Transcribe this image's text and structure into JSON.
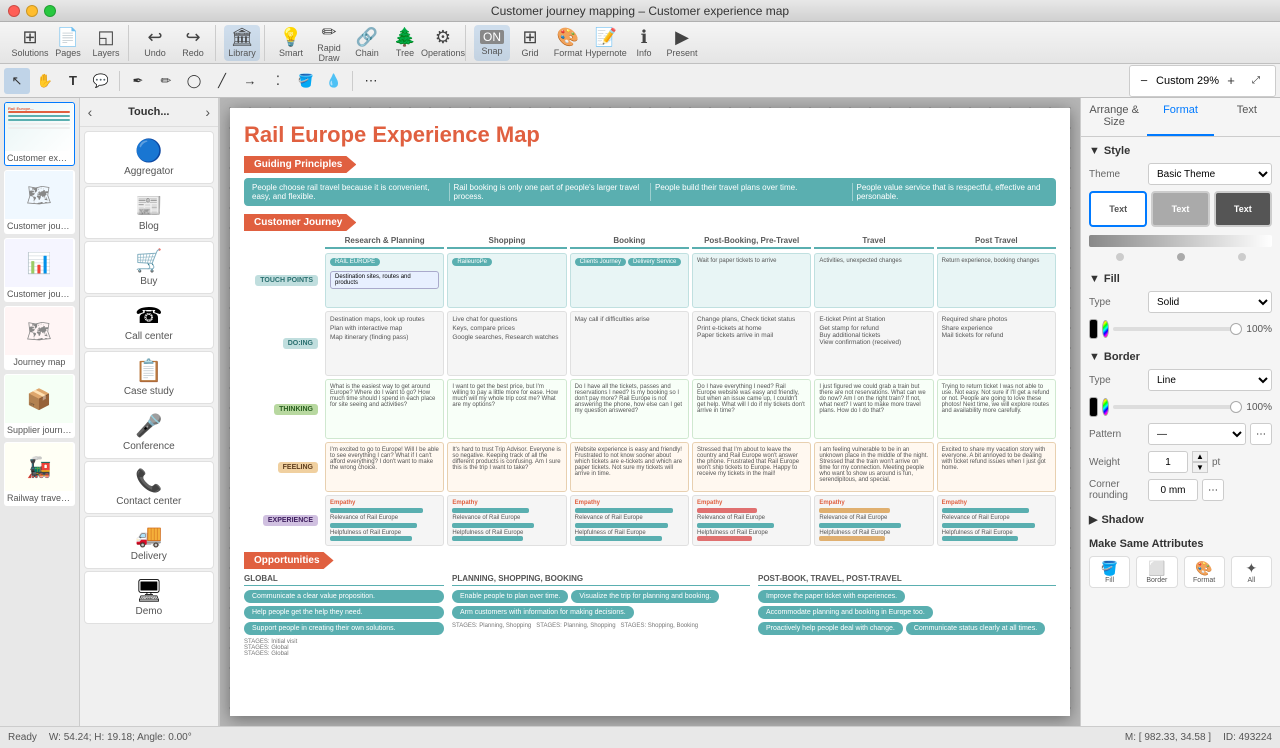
{
  "window": {
    "title": "Customer journey mapping – Customer experience map"
  },
  "toolbar_top": {
    "sections": [
      {
        "items": [
          {
            "id": "solutions",
            "label": "Solutions",
            "icon": "⊞"
          },
          {
            "id": "pages",
            "label": "Pages",
            "icon": "📄"
          },
          {
            "id": "layers",
            "label": "Layers",
            "icon": "◱"
          }
        ]
      },
      {
        "items": [
          {
            "id": "undo",
            "label": "Undo",
            "icon": "↩"
          },
          {
            "id": "redo",
            "label": "Redo",
            "icon": "↪"
          }
        ]
      },
      {
        "items": [
          {
            "id": "library",
            "label": "Library",
            "icon": "🏛",
            "active": true
          }
        ]
      },
      {
        "items": [
          {
            "id": "smart",
            "label": "Smart",
            "icon": "💡"
          },
          {
            "id": "rapid-draw",
            "label": "Rapid Draw",
            "icon": "✏"
          },
          {
            "id": "chain",
            "label": "Chain",
            "icon": "🔗"
          },
          {
            "id": "tree",
            "label": "Tree",
            "icon": "🌲"
          },
          {
            "id": "operations",
            "label": "Operations",
            "icon": "⚙"
          }
        ]
      },
      {
        "items": [
          {
            "id": "snap",
            "label": "Snap",
            "icon": "⊞",
            "active": true
          },
          {
            "id": "grid",
            "label": "Grid",
            "icon": "⊞"
          },
          {
            "id": "format",
            "label": "Format",
            "icon": "🎨"
          },
          {
            "id": "hypernote",
            "label": "Hypernote",
            "icon": "📝"
          },
          {
            "id": "info",
            "label": "Info",
            "icon": "ℹ"
          },
          {
            "id": "present",
            "label": "Present",
            "icon": "▶"
          }
        ]
      }
    ]
  },
  "tools": {
    "items": [
      {
        "id": "select",
        "icon": "↖",
        "active": true
      },
      {
        "id": "hand",
        "icon": "✋"
      },
      {
        "id": "text",
        "icon": "T"
      },
      {
        "id": "note",
        "icon": "💬"
      },
      {
        "id": "separator1"
      },
      {
        "id": "pen",
        "icon": "✒"
      },
      {
        "id": "pencil",
        "icon": "✏"
      },
      {
        "id": "shape",
        "icon": "◯"
      },
      {
        "id": "line",
        "icon": "╱"
      },
      {
        "id": "arrow",
        "icon": "→"
      },
      {
        "id": "eraser",
        "icon": "⬛"
      },
      {
        "id": "paintbucket",
        "icon": "🪣"
      },
      {
        "id": "eyedropper",
        "icon": "💧"
      },
      {
        "id": "separator2"
      },
      {
        "id": "more",
        "icon": "⋯"
      }
    ],
    "zoom": {
      "zoom_out": "−",
      "value": "Custom 29%",
      "zoom_in": "+"
    }
  },
  "library_panel": {
    "title": "Touch...",
    "prev_label": "‹",
    "next_label": "›",
    "items": [
      {
        "id": "aggregator",
        "icon": "🔵",
        "name": "Aggregator"
      },
      {
        "id": "blog",
        "icon": "📰",
        "name": "Blog"
      },
      {
        "id": "buy",
        "icon": "🛒",
        "name": "Buy"
      },
      {
        "id": "call-center",
        "icon": "☎",
        "name": "Call center"
      },
      {
        "id": "case-study",
        "icon": "📋",
        "name": "Case study"
      },
      {
        "id": "conference",
        "icon": "🎤",
        "name": "Conference"
      },
      {
        "id": "contact-center",
        "icon": "📞",
        "name": "Contact center"
      },
      {
        "id": "delivery",
        "icon": "🚚",
        "name": "Delivery"
      },
      {
        "id": "demo",
        "icon": "🖥",
        "name": "Demo"
      }
    ]
  },
  "thumbnails": [
    {
      "id": "thumb1",
      "label": "Customer experi...",
      "active": true
    },
    {
      "id": "thumb2",
      "label": "Customer journey map"
    },
    {
      "id": "thumb3",
      "label": "Customer journey ..."
    },
    {
      "id": "thumb4",
      "label": "Journey map"
    },
    {
      "id": "thumb5",
      "label": "Supplier journey map"
    },
    {
      "id": "thumb6",
      "label": "Railway travel CJ..."
    }
  ],
  "canvas": {
    "map_title": "Rail Europe Experience Map",
    "sections": {
      "guiding_principles": {
        "label": "Guiding Principles",
        "cells": [
          "People choose rail travel because it is convenient, easy, and flexible.",
          "Rail booking is only one part of people's larger travel process.",
          "People build their travel plans over time.",
          "People value service that is respectful, effective and personable."
        ]
      },
      "customer_journey": {
        "label": "Customer Journey",
        "stages": [
          "Research & Planning",
          "Shopping",
          "Booking",
          "Post-Booking, Pre-Travel",
          "Travel",
          "Post Travel"
        ],
        "rows": {
          "touchpoints": "TOUCHPOINTS",
          "doing": "DO:ING",
          "thinking": "THINKING",
          "feeling": "FEELING",
          "experience": "EXPERIENCE"
        }
      },
      "opportunities": {
        "label": "Opportunities",
        "groups": [
          {
            "title": "GLOBAL",
            "pills": [
              "Communicate a clear value proposition.",
              "Help people get the help they need.",
              "Support people in creating their own solutions."
            ]
          },
          {
            "title": "PLANNING, SHOPPING, BOOKING",
            "pills": [
              "Enable people to plan over time.",
              "Visualize the trip for planning and booking.",
              "Arm customers with information for making decisions."
            ]
          },
          {
            "title": "POST-BOOK, TRAVEL, POST-TRAVEL",
            "pills": [
              "Improve the paper ticket with experiences.",
              "Accommodate planning and booking in Europe too.",
              "Proactively help people deal with change.",
              "Communicate status clearly at all times."
            ]
          }
        ]
      }
    }
  },
  "right_panel": {
    "tabs": [
      "Arrange & Size",
      "Format",
      "Text"
    ],
    "active_tab": "Format",
    "style": {
      "label": "Style",
      "theme_label": "Theme",
      "theme_value": "Basic Theme",
      "theme_options": [
        {
          "label": "Text",
          "style": "plain"
        },
        {
          "label": "Text",
          "style": "mid"
        },
        {
          "label": "Text",
          "style": "dark"
        }
      ]
    },
    "fill": {
      "label": "Fill",
      "type_label": "Type",
      "type_value": "Solid",
      "color": "#000000",
      "opacity": "100%"
    },
    "border": {
      "label": "Border",
      "type_label": "Type",
      "type_value": "Line",
      "color": "#000000",
      "opacity": "100%",
      "pattern_label": "Pattern",
      "pattern_value": "—",
      "weight_label": "Weight",
      "weight_value": "1",
      "weight_unit": "pt",
      "corner_label": "Corner rounding",
      "corner_value": "0 mm"
    },
    "shadow": {
      "label": "Shadow"
    },
    "make_same": {
      "label": "Make Same Attributes",
      "buttons": [
        "Fill",
        "Border",
        "Format",
        "All"
      ]
    },
    "format_icons": [
      "Fill",
      "Border",
      "Format",
      "All"
    ]
  },
  "status_bar": {
    "ready": "Ready",
    "size": "W: 54.24; H: 19.18; Angle: 0.00°",
    "mouse": "M: [ 982.33, 34.58 ]",
    "id": "ID: 493224"
  }
}
